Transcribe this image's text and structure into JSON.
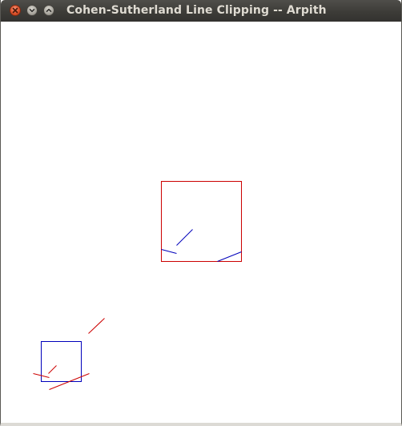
{
  "window": {
    "title": "Cohen-Sutherland Line Clipping -- Arpith",
    "controls": {
      "close_icon": "close-icon",
      "minimize_icon": "chevron-down-icon",
      "maximize_icon": "chevron-up-icon"
    }
  },
  "colors": {
    "titlebar": "#3c3b37",
    "title_text": "#dfdbd2",
    "close_button": "#e0532c",
    "canvas_background": "#ffffff",
    "red": "#cc0000",
    "blue": "#0000bb"
  }
}
